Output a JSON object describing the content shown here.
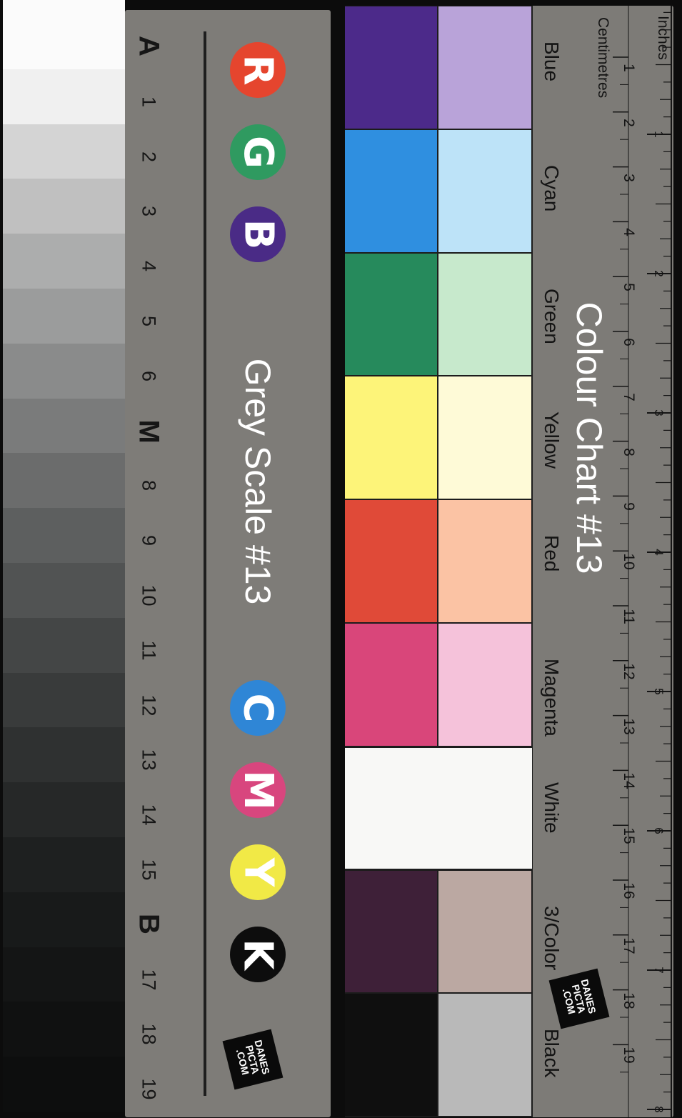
{
  "grey_card": {
    "title": "Grey Scale #13",
    "rgb_badges": [
      {
        "letter": "R",
        "color": "#e5452e"
      },
      {
        "letter": "G",
        "color": "#2f9a60"
      },
      {
        "letter": "B",
        "color": "#4a2b86"
      }
    ],
    "cmyk_badges": [
      {
        "letter": "C",
        "color": "#2f86d6"
      },
      {
        "letter": "M",
        "color": "#d8467e"
      },
      {
        "letter": "Y",
        "color": "#f1e946"
      },
      {
        "letter": "K",
        "color": "#0d0d0d"
      }
    ],
    "step_labels": [
      "A",
      "1",
      "2",
      "3",
      "4",
      "5",
      "6",
      "M",
      "8",
      "9",
      "10",
      "11",
      "12",
      "13",
      "14",
      "15",
      "B",
      "17",
      "18",
      "19"
    ],
    "logo": "DANES\nPICTA\n.COM"
  },
  "grey_scale_colors": [
    "#fbfbfb",
    "#f0f0f0",
    "#d4d4d4",
    "#c0c0c0",
    "#acadad",
    "#9b9c9c",
    "#8a8b8b",
    "#7a7b7b",
    "#6b6c6c",
    "#5d5f5f",
    "#515353",
    "#444646",
    "#393b3b",
    "#2f3131",
    "#262828",
    "#1e2020",
    "#181a1a",
    "#141515",
    "#101111",
    "#0d0e0e"
  ],
  "colour_card": {
    "title": "Colour Chart #13",
    "colours": [
      {
        "name": "Blue",
        "strong": "#4c2a8a",
        "light": "#b9a3d9"
      },
      {
        "name": "Cyan",
        "strong": "#2f8fe0",
        "light": "#bde3f8"
      },
      {
        "name": "Green",
        "strong": "#268a5c",
        "light": "#c7e9cc"
      },
      {
        "name": "Yellow",
        "strong": "#fdf479",
        "light": "#fefad7"
      },
      {
        "name": "Red",
        "strong": "#e04a38",
        "light": "#fbc3a4"
      },
      {
        "name": "Magenta",
        "strong": "#d9467a",
        "light": "#f5c2da"
      },
      {
        "name": "White",
        "strong": "#f8f8f6",
        "light": "#f8f8f6"
      },
      {
        "name": "3/Color",
        "strong": "#3e2038",
        "light": "#bba8a2"
      },
      {
        "name": "Black",
        "strong": "#0f0f0f",
        "light": "#b9b9b9"
      }
    ],
    "logo": "DANES\nPICTA\n.COM"
  },
  "ruler": {
    "centimetres_label": "Centimetres",
    "inches_label": "Inches",
    "cm_numbers": [
      "1",
      "2",
      "3",
      "4",
      "5",
      "6",
      "7",
      "8",
      "9",
      "10",
      "11",
      "12",
      "13",
      "14",
      "15",
      "16",
      "17",
      "18",
      "19"
    ],
    "inch_numbers": [
      "1",
      "2",
      "3",
      "4",
      "5",
      "6",
      "7",
      "8"
    ]
  }
}
